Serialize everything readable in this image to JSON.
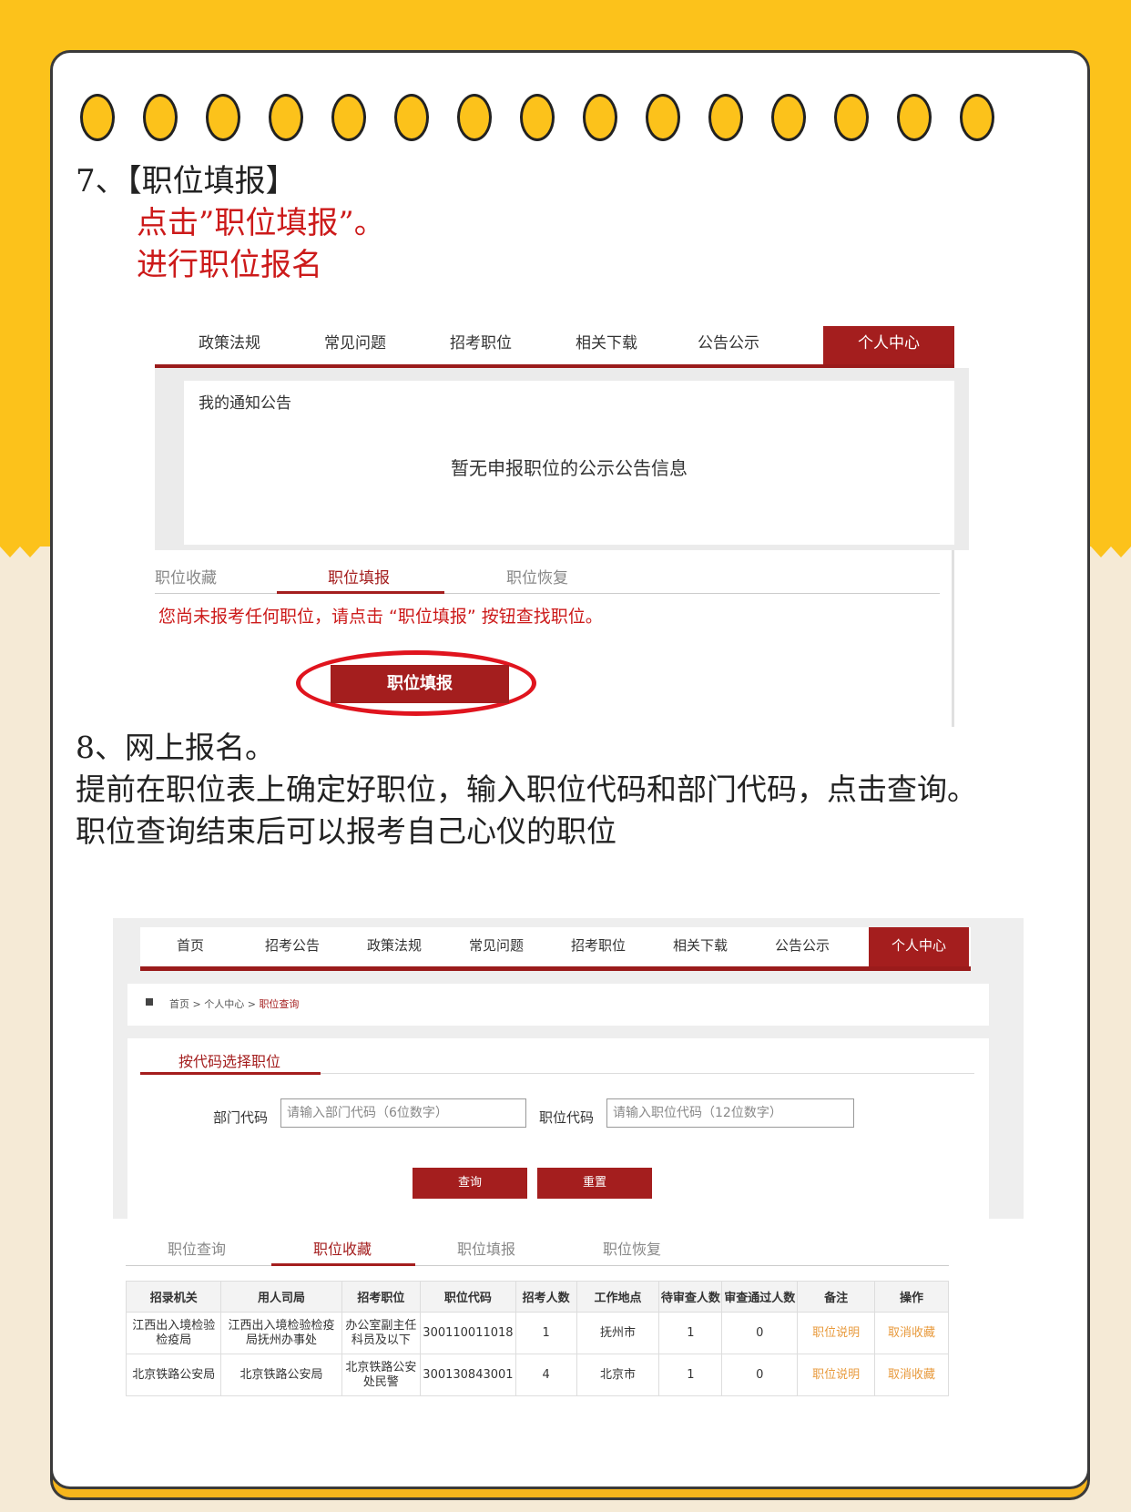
{
  "step7": {
    "title": "7、【职位填报】",
    "line1": "点击”职位填报”。",
    "line2": "进行职位报名"
  },
  "shot1": {
    "nav": [
      "政策法规",
      "常见问题",
      "招考职位",
      "相关下载",
      "公告公示",
      "个人中心"
    ],
    "notice_title": "我的通知公告",
    "notice_empty": "暂无申报职位的公示公告信息",
    "tabs": [
      "职位收藏",
      "职位填报",
      "职位恢复"
    ],
    "warning": "您尚未报考任何职位，请点击 “职位填报” 按钮查找职位。",
    "button": "职位填报"
  },
  "step8": {
    "title": "8、网上报名。",
    "body": "提前在职位表上确定好职位，输入职位代码和部门代码，点击查询。职位查询结束后可以报考自己心仪的职位"
  },
  "shot2": {
    "nav": [
      "首页",
      "招考公告",
      "政策法规",
      "常见问题",
      "招考职位",
      "相关下载",
      "公告公示",
      "个人中心"
    ],
    "breadcrumb": [
      "首页",
      "个人中心",
      "职位查询"
    ],
    "query_title": "按代码选择职位",
    "dept_label": "部门代码",
    "dept_placeholder": "请输入部门代码（6位数字）",
    "pos_label": "职位代码",
    "pos_placeholder": "请输入职位代码（12位数字）",
    "query_btn": "查询",
    "reset_btn": "重置",
    "tabs": [
      "职位查询",
      "职位收藏",
      "职位填报",
      "职位恢复"
    ],
    "headers": [
      "招录机关",
      "用人司局",
      "招考职位",
      "职位代码",
      "招考人数",
      "工作地点",
      "待审查人数",
      "审查通过人数",
      "备注",
      "操作"
    ],
    "rows": [
      [
        "江西出入境检验检疫局",
        "江西出入境检验检疫局抚州办事处",
        "办公室副主任科员及以下",
        "300110011018",
        "1",
        "抚州市",
        "1",
        "0",
        "职位说明",
        "取消收藏"
      ],
      [
        "北京铁路公安局",
        "北京铁路公安局",
        "北京铁路公安处民警",
        "300130843001",
        "4",
        "北京市",
        "1",
        "0",
        "职位说明",
        "取消收藏"
      ]
    ]
  },
  "colors": {
    "yellow": "#fcc21b",
    "cream": "#f5ead6",
    "brand_red": "#a41e1e",
    "highlight_red": "#e0141e"
  }
}
